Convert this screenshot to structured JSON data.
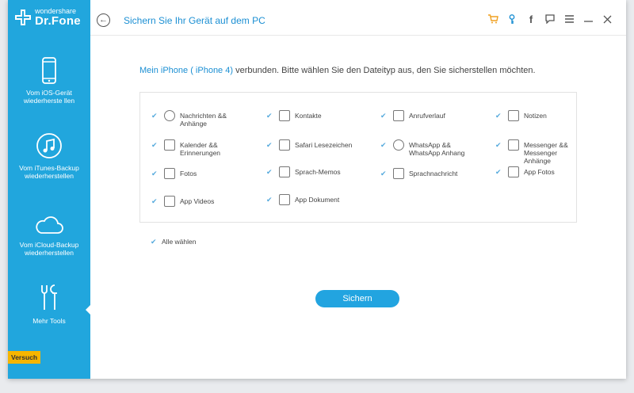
{
  "app": {
    "brand_small": "wondershare",
    "brand_big": "Dr.Fone",
    "trial_badge": "Versuch"
  },
  "sidebar": {
    "items": [
      {
        "label": "Vom iOS-Gerät wiederherste llen",
        "icon": "iphone-icon"
      },
      {
        "label": "Vom iTunes-Backup wiederherstellen",
        "icon": "itunes-icon"
      },
      {
        "label": "Vom iCloud-Backup wiederherstellen",
        "icon": "cloud-icon"
      },
      {
        "label": "Mehr Tools",
        "icon": "tools-icon"
      }
    ]
  },
  "header": {
    "title": "Sichern Sie Ihr Gerät auf dem PC",
    "icons": [
      "cart-icon",
      "key-icon",
      "facebook-icon",
      "feedback-icon",
      "menu-icon",
      "minimize-icon",
      "close-icon"
    ]
  },
  "main": {
    "device_prefix": "Mein iPhone ( iPhone 4)",
    "device_suffix": " verbunden. Bitte wählen Sie den Dateityp aus, den Sie sicherstellen möchten.",
    "types": [
      {
        "label": "Nachrichten && Anhänge",
        "checked": true
      },
      {
        "label": "Kontakte",
        "checked": true
      },
      {
        "label": "Anrufverlauf",
        "checked": true
      },
      {
        "label": "Notizen",
        "checked": true
      },
      {
        "label": "Kalender && Erinnerungen",
        "checked": true
      },
      {
        "label": "Safari Lesezeichen",
        "checked": true
      },
      {
        "label": "WhatsApp && WhatsApp Anhang",
        "checked": true
      },
      {
        "label": "Messenger && Messenger Anhänge",
        "checked": true
      },
      {
        "label": "Fotos",
        "checked": true
      },
      {
        "label": "Sprach-Memos",
        "checked": true
      },
      {
        "label": "Sprachnachricht",
        "checked": true
      },
      {
        "label": "App Fotos",
        "checked": true
      },
      {
        "label": "App Videos",
        "checked": true
      },
      {
        "label": "App Dokument",
        "checked": true
      }
    ],
    "select_all": "Alle wählen",
    "save_button": "Sichern"
  },
  "colors": {
    "sidebar": "#21a6dd",
    "accent": "#1b8fd3",
    "trial": "#f6b500"
  }
}
